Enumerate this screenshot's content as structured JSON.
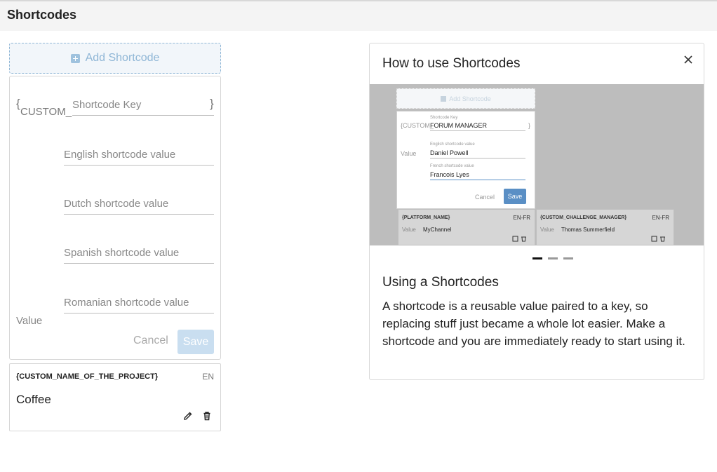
{
  "header": {
    "title": "Shortcodes"
  },
  "add_button": {
    "label": "Add Shortcode"
  },
  "form": {
    "brace_open": "{",
    "prefix": "CUSTOM_",
    "brace_close": "}",
    "key_placeholder": "Shortcode Key",
    "value_label": "Value",
    "fields": [
      {
        "placeholder": "English shortcode value"
      },
      {
        "placeholder": "Dutch shortcode value"
      },
      {
        "placeholder": "Spanish shortcode value"
      },
      {
        "placeholder": "Romanian shortcode value"
      }
    ],
    "cancel_label": "Cancel",
    "save_label": "Save"
  },
  "shortcode_card": {
    "key": "{CUSTOM_NAME_OF_THE_PROJECT}",
    "lang": "EN",
    "value": "Coffee"
  },
  "help": {
    "title": "How to use Shortcodes",
    "subtitle": "Using a Shortcodes",
    "body": "A shortcode is a reusable value paired to a key, so replacing stuff just became a whole lot easier. Make a shortcode and you are immediately ready to start using it.",
    "slides_count": 3,
    "active_slide": 1,
    "slide": {
      "add_label": "Add Shortcode",
      "key_small_label": "Shortcode Key",
      "prefix": "{CUSTOM_",
      "key_value": "FORUM MANAGER",
      "brace_close": "}",
      "value_label": "Value",
      "english_small_label": "English shortcode value",
      "english_value": "Daniel Powell",
      "french_small_label": "French shortcode value",
      "french_value": "Francois Lyes",
      "cancel_label": "Cancel",
      "save_label": "Save",
      "cards": [
        {
          "key": "{PLATFORM_NAME}",
          "lang": "EN-FR",
          "value_label": "Value",
          "value": "MyChannel"
        },
        {
          "key": "{CUSTOM_CHALLENGE_MANAGER}",
          "lang": "EN-FR",
          "value_label": "Value",
          "value": "Thomas Summerfield"
        }
      ]
    }
  }
}
